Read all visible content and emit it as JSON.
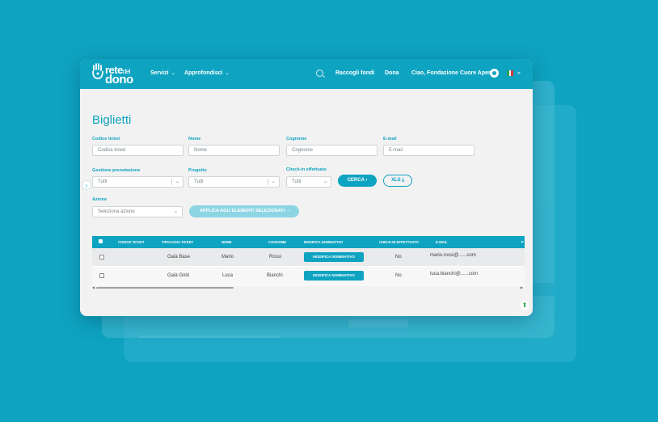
{
  "app": {
    "logo_top": "rete",
    "logo_small": "del",
    "logo_bottom": "dono",
    "nav": {
      "servizi": "Servizi",
      "approfondisci": "Approfondisci",
      "raccogli": "Raccogli fondi",
      "dona": "Dona",
      "user": "Ciao, Fondazione Cuore Aperto"
    },
    "icons": [
      "hand-logo-icon",
      "chevron-down-icon",
      "search-icon",
      "avatar-icon",
      "italy-flag-icon",
      "download-icon",
      "upload-icon",
      "chevron-right-icon"
    ],
    "colors": {
      "accent": "#0ea3c1",
      "accent_light": "#8ed5e4",
      "background": "#0ea3c1",
      "panel": "#f2f2f2"
    }
  },
  "page": {
    "title": "Biglietti",
    "filters": {
      "codice_label": "Codice ticket",
      "codice_placeholder": "Codice ticket",
      "nome_label": "Nome",
      "nome_placeholder": "Nome",
      "cognome_label": "Cognome",
      "cognome_placeholder": "Cognome",
      "email_label": "E-mail",
      "email_placeholder": "E-mail",
      "gestione_label": "Gestione prenotazione",
      "gestione_value": "Tutti",
      "progetto_label": "Progetto",
      "progetto_value": "Tutti",
      "checkin_label": "Check-in effettuato",
      "checkin_value": "Tutti",
      "cerca": "CERCA",
      "xls": "XLS",
      "azione_label": "Azione",
      "azione_value": "Seleziona azione",
      "applica": "APPLICA AGLI ELEMENTI SELEZIONATI"
    },
    "table": {
      "headers": [
        "CODICE TICKET",
        "TIPOLOGIA TICKET",
        "NOME",
        "COGNOME",
        "MODIFICA NOMINATIVO",
        "CHECK-IN EFFETTUATO",
        "E-MAIL",
        "P"
      ],
      "rows": [
        {
          "codice": "",
          "tipologia": "Galà Base",
          "nome": "Mario",
          "cognome": "Rossi",
          "modifica": "MODIFICA NOMINATIVO",
          "checkin": "No",
          "email": "mario.rossi@......com"
        },
        {
          "codice": "",
          "tipologia": "Galà Gold",
          "nome": "Luca",
          "cognome": "Bianchi",
          "modifica": "MODIFICA NOMINATIVO",
          "checkin": "No",
          "email": "luca.bianchi@......com"
        }
      ]
    }
  }
}
